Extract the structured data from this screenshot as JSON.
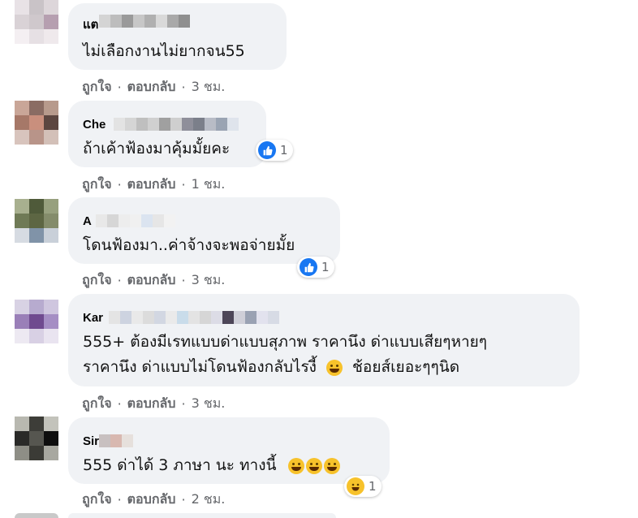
{
  "comments": [
    {
      "name": "แต",
      "text": "ไม่เลือกงานไม่ยากจน55",
      "like": "ถูกใจ",
      "reply": "ตอบกลับ",
      "time": "3 ชม.",
      "reactions": ""
    },
    {
      "name": "Che",
      "text": "ถ้าเค้าฟ้องมาคุ้มมั้ยคะ",
      "like": "ถูกใจ",
      "reply": "ตอบกลับ",
      "time": "1 ชม.",
      "reactions": "1"
    },
    {
      "name": "A",
      "text": "โดนฟ้องมา..ค่าจ้างจะพอจ่ายมั้ย",
      "like": "ถูกใจ",
      "reply": "ตอบกลับ",
      "time": "3 ชม.",
      "reactions": "1"
    },
    {
      "name": "Kar",
      "text_line1": "555+ ต้องมีเรทแบบด่าแบบสุภาพ ราคานึง ด่าแบบเสียๆหายๆ",
      "text_line2a": "ราคานึง ด่าแบบไม่โดนฟ้องกลับไรงี้",
      "text_line2b": "ช้อยส์เยอะๆๆนิด",
      "like": "ถูกใจ",
      "reply": "ตอบกลับ",
      "time": "3 ชม.",
      "reactions": ""
    },
    {
      "name": "Sir",
      "text": "555 ด่าได้ 3 ภาษา นะ ทางนี้",
      "like": "ถูกใจ",
      "reply": "ตอบกลับ",
      "time": "2 ชม.",
      "reactions": "1"
    }
  ],
  "separator": "·",
  "icons": {
    "like": "like-icon",
    "haha": "haha-icon"
  },
  "colors": {
    "bubble": "#f0f2f5",
    "meta": "#65676b",
    "like_blue": "#1877f2"
  }
}
